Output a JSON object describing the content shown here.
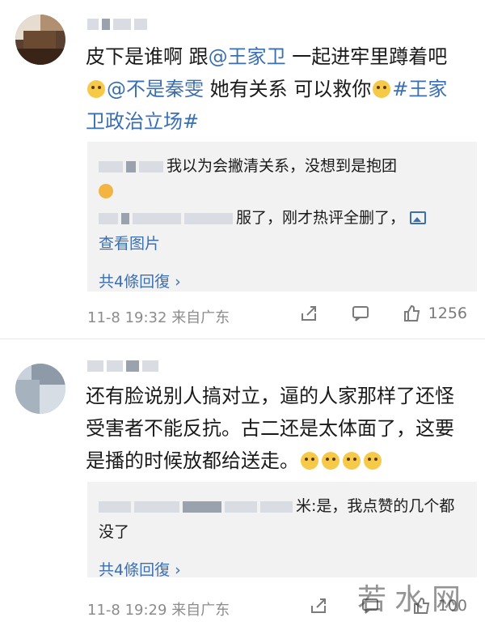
{
  "comments": [
    {
      "text_part1": "皮下是谁啊 跟",
      "mention1": "@王家卫",
      "text_part2": " 一起进牢里蹲着吧",
      "mention2": "@不是秦雯",
      "text_part3": " 她有关系 可以救你",
      "hashtag": "#王家卫政治立场#",
      "replies": [
        {
          "text": "我以为会撇清关系，没想到是抱团"
        },
        {
          "text": "服了，刚才热评全删了，",
          "more": "查看图片"
        }
      ],
      "reply_count": "共4條回復",
      "time": "11-8 19:32",
      "source": "来自广东",
      "likes": "1256"
    },
    {
      "text": "还有脸说别人搞对立，逼的人家那样了还怪受害者不能反抗。古二还是太体面了，这要是播的时候放都给送走。",
      "replies": [
        {
          "text": "米:是，我点赞的几个都没了"
        }
      ],
      "reply_count": "共4條回復",
      "time": "11-8 19:29",
      "source": "来自广东",
      "likes": "100"
    }
  ],
  "icons": {
    "share": "share-icon",
    "comment": "comment-icon",
    "like": "like-icon"
  },
  "colors": {
    "link": "#3b6fb3",
    "meta": "#8c8c8c",
    "reply_bg": "#f2f2f2"
  },
  "watermark": "若水网"
}
